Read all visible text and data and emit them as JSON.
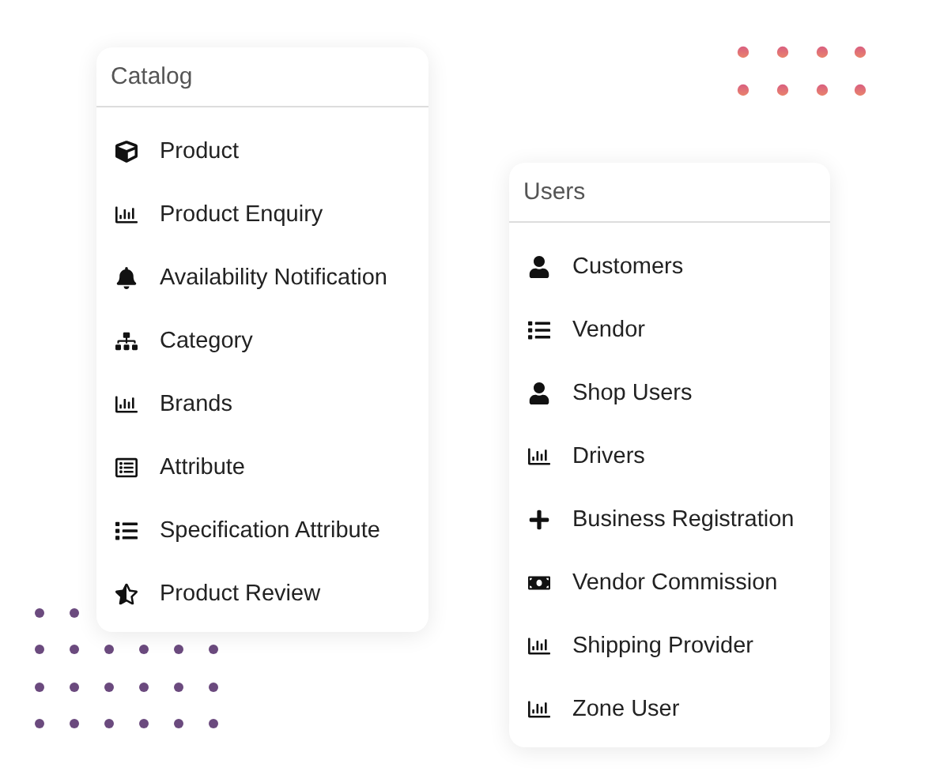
{
  "cards": [
    {
      "title": "Catalog",
      "items": [
        {
          "label": "Product",
          "kind": "cube"
        },
        {
          "label": "Product Enquiry",
          "kind": "chart"
        },
        {
          "label": "Availability Notification",
          "kind": "bell"
        },
        {
          "label": "Category",
          "kind": "sitemap"
        },
        {
          "label": "Brands",
          "kind": "chart"
        },
        {
          "label": "Attribute",
          "kind": "listalt"
        },
        {
          "label": "Specification Attribute",
          "kind": "list"
        },
        {
          "label": "Product Review",
          "kind": "starhalf"
        }
      ]
    },
    {
      "title": "Users",
      "items": [
        {
          "label": "Customers",
          "kind": "user"
        },
        {
          "label": "Vendor",
          "kind": "list"
        },
        {
          "label": "Shop Users",
          "kind": "user"
        },
        {
          "label": "Drivers",
          "kind": "chart"
        },
        {
          "label": "Business Registration",
          "kind": "plus"
        },
        {
          "label": "Vendor Commission",
          "kind": "money"
        },
        {
          "label": "Shipping Provider",
          "kind": "chart"
        },
        {
          "label": "Zone User",
          "kind": "chart"
        }
      ]
    }
  ]
}
